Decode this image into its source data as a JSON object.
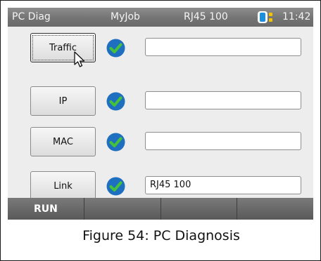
{
  "status_bar": {
    "app_title": "PC Diag",
    "job_name": "MyJob",
    "port": "RJ45 100",
    "time": "11:42",
    "battery_icon": "battery-icon"
  },
  "tests": [
    {
      "label": "Traffic",
      "status": "passed",
      "status_icon": "checkmark-icon",
      "result": ""
    },
    {
      "label": "IP",
      "status": "passed",
      "status_icon": "checkmark-icon",
      "result": ""
    },
    {
      "label": "MAC",
      "status": "passed",
      "status_icon": "checkmark-icon",
      "result": ""
    },
    {
      "label": "Link",
      "status": "passed",
      "status_icon": "checkmark-icon",
      "result": "RJ45 100"
    }
  ],
  "softkeys": [
    "RUN",
    "",
    "",
    ""
  ],
  "caption": "Figure 54: PC Diagnosis",
  "colors": {
    "check_blue": "#1f6fc0",
    "check_green": "#46c23a",
    "battery_blue": "#1a8fe0",
    "battery_yellow": "#f5c400"
  }
}
